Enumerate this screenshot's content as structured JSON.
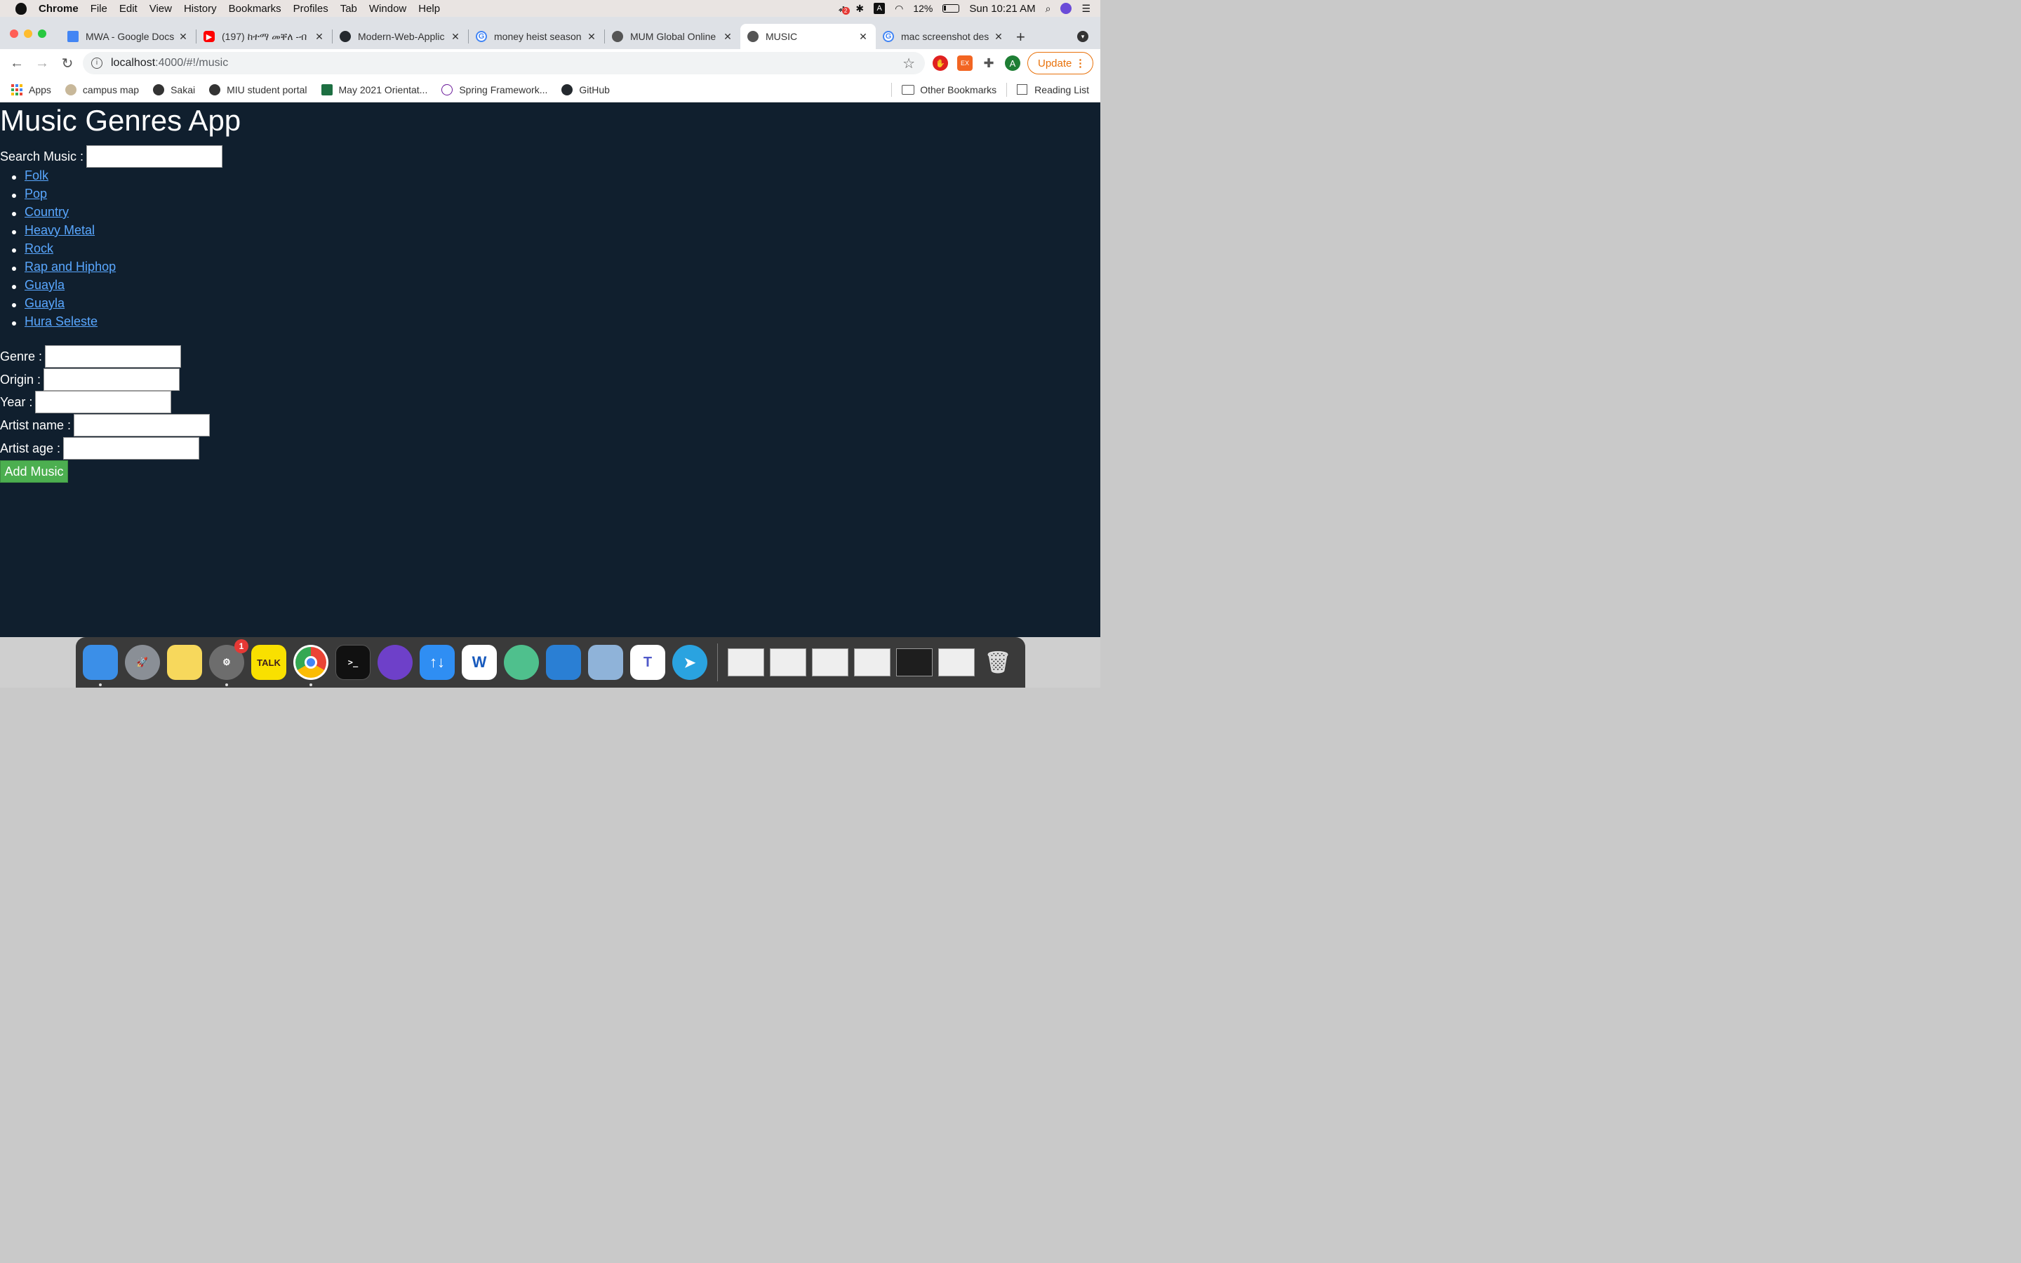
{
  "menubar": {
    "app": "Chrome",
    "items": [
      "File",
      "Edit",
      "View",
      "History",
      "Bookmarks",
      "Profiles",
      "Tab",
      "Window",
      "Help"
    ],
    "status": {
      "notif_badge": "2",
      "input_source": "A",
      "battery": "12%",
      "clock": "Sun 10:21 AM"
    }
  },
  "tabs": [
    {
      "title": "MWA - Google Docs",
      "color": "#4285f4"
    },
    {
      "title": "(197) ከተማ መቐለ -ብ",
      "color": "#ff0000"
    },
    {
      "title": "Modern-Web-Applic",
      "color": "#24292e"
    },
    {
      "title": "money heist season",
      "color": "#4285f4"
    },
    {
      "title": "MUM Global Online",
      "color": "#555555"
    },
    {
      "title": "MUSIC",
      "color": "#555555",
      "active": true
    },
    {
      "title": "mac screenshot des",
      "color": "#4285f4"
    }
  ],
  "toolbar": {
    "url_host": "localhost",
    "url_path": ":4000/#!/music",
    "ext_ex_label": "EX",
    "profile_initial": "A",
    "update_label": "Update"
  },
  "bookmarks": {
    "items": [
      "Apps",
      "campus map",
      "Sakai",
      "MIU student portal",
      "May 2021 Orientat...",
      "Spring Framework...",
      "GitHub"
    ],
    "other": "Other Bookmarks",
    "reading_list": "Reading List"
  },
  "app": {
    "title": "Music Genres App",
    "search_label": "Search Music :",
    "genres": [
      "Folk",
      "Pop",
      "Country",
      "Heavy Metal",
      "Rock",
      "Rap and Hiphop",
      "Guayla",
      "Guayla",
      "Hura Seleste"
    ],
    "form": {
      "genre_label": "Genre :",
      "origin_label": "Origin :",
      "year_label": "Year :",
      "artist_name_label": "Artist name :",
      "artist_age_label": "Artist age :"
    },
    "add_button": "Add Music",
    "colors": {
      "background": "#101f2e",
      "link": "#59a7ff",
      "button": "#4caf50"
    }
  },
  "dock": {
    "apps": [
      {
        "name": "finder-icon",
        "label": "",
        "color": "#3b8fe8"
      },
      {
        "name": "launchpad-icon",
        "label": "",
        "color": "#8a8f96"
      },
      {
        "name": "notes-icon",
        "label": "",
        "color": "#f7d85c"
      },
      {
        "name": "system-preferences-icon",
        "label": "",
        "color": "#6d6d6d",
        "badge": "1"
      },
      {
        "name": "kakaotalk-icon",
        "label": "TALK",
        "color": "#f9e000"
      },
      {
        "name": "chrome-icon",
        "label": "",
        "color": "#ffffff"
      },
      {
        "name": "terminal-icon",
        "label": ">_",
        "color": "#111111"
      },
      {
        "name": "github-desktop-icon",
        "label": "",
        "color": "#6e40c9"
      },
      {
        "name": "transporter-icon",
        "label": "↑↓",
        "color": "#2f8ef3"
      },
      {
        "name": "word-icon",
        "label": "W",
        "color": "#ffffff"
      },
      {
        "name": "atom-icon",
        "label": "",
        "color": "#4fc08d"
      },
      {
        "name": "vscode-icon",
        "label": "",
        "color": "#2a7fd4"
      },
      {
        "name": "preview-icon",
        "label": "",
        "color": "#8fb3d9"
      },
      {
        "name": "teams-icon",
        "label": "T",
        "color": "#ffffff"
      },
      {
        "name": "telegram-icon",
        "label": "",
        "color": "#2aa3e0"
      }
    ],
    "windows": 6
  }
}
